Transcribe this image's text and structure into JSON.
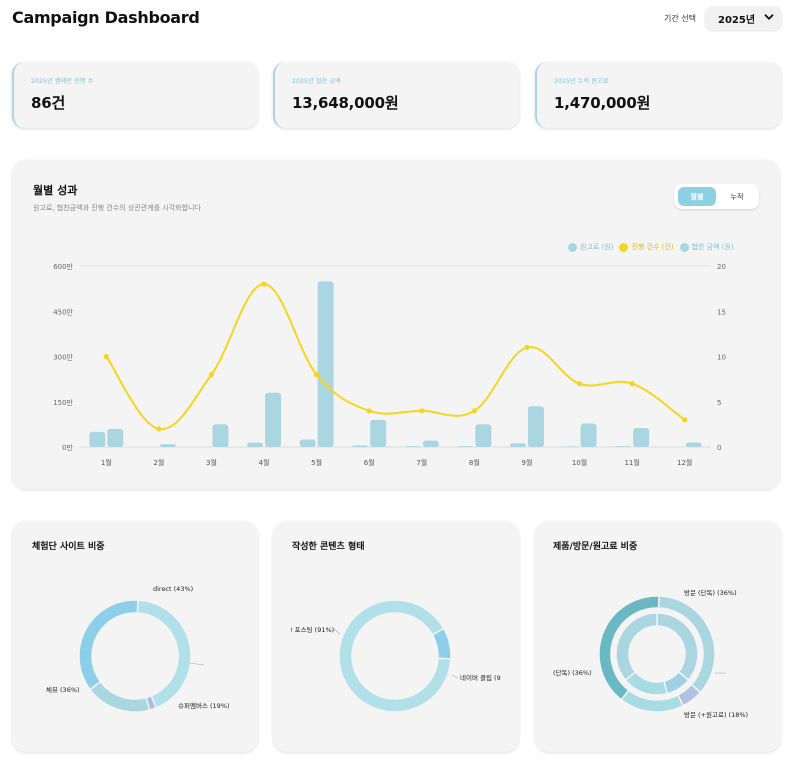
{
  "header": {
    "title": "Campaign Dashboard",
    "period_label": "기간 선택",
    "period_value": "2025년"
  },
  "stats": [
    {
      "label": "2025년 캠페인 진행 수",
      "value": "86건"
    },
    {
      "label": "2025년 협찬 금액",
      "value": "13,648,000원"
    },
    {
      "label": "2025년 누적 원고료",
      "value": "1,470,000원"
    }
  ],
  "monthly": {
    "title": "월별 성과",
    "subtitle": "원고료, 협찬금액과 진행 건수의 상관관계를 시각화합니다",
    "toggle": [
      "월별",
      "누적"
    ],
    "legend": [
      {
        "label": "원고료 (원)",
        "color": "#a9d6e1"
      },
      {
        "label": "진행 건수 (건)",
        "color": "#f7d51c"
      },
      {
        "label": "협찬 금액 (원)",
        "color": "#a9d6e1"
      }
    ]
  },
  "chart_data": [
    {
      "type": "bar",
      "categories": [
        "1월",
        "2월",
        "3월",
        "4월",
        "5월",
        "6월",
        "7월",
        "8월",
        "9월",
        "10월",
        "11월",
        "12월"
      ],
      "series": [
        {
          "name": "원고료 (원)",
          "type": "bar",
          "axis": "left",
          "values": [
            500000,
            0,
            0,
            150000,
            250000,
            50000,
            30000,
            30000,
            120000,
            20000,
            30000,
            0
          ],
          "color": "#a9d6e1"
        },
        {
          "name": "진행 건수 (건)",
          "type": "line",
          "axis": "right",
          "values": [
            10,
            2,
            8,
            18,
            8,
            4,
            4,
            4,
            11,
            7,
            7,
            3
          ],
          "color": "#f7d51c"
        },
        {
          "name": "협찬 금액 (원)",
          "type": "bar",
          "axis": "right",
          "values": [
            2,
            0.3,
            2.5,
            6,
            18.3,
            3,
            0.7,
            2.5,
            4.5,
            2.6,
            2.1,
            0.5
          ],
          "color": "#a9d6e1"
        }
      ],
      "y_left": {
        "ticks": [
          "0만",
          "150만",
          "300만",
          "450만",
          "600만"
        ],
        "range": [
          0,
          6000000
        ]
      },
      "y_right": {
        "ticks": [
          "0",
          "5",
          "10",
          "15",
          "20"
        ],
        "range": [
          0,
          20
        ]
      },
      "grid": false,
      "legend": "top-right"
    },
    {
      "type": "pie",
      "title": "체험단 사이트 비중",
      "labels": [
        "direct (43%)",
        "",
        "슈퍼멤버스 (19%)",
        "체뷰 (36%)"
      ],
      "values": [
        43,
        2,
        19,
        36
      ],
      "colors": [
        "#b2e0e8",
        "#a9bde6",
        "#a9d6e1",
        "#8dcfe8"
      ]
    },
    {
      "type": "pie",
      "title": "작성한 콘텐츠 형태",
      "labels": [
        "! 포스팅 (91%)",
        "네이버 클립 (9"
      ],
      "values": [
        91,
        9
      ],
      "colors": [
        "#b2e0e8",
        "#8dcfe8"
      ]
    },
    {
      "type": "pie",
      "title": "제품/방문/원고료 비중",
      "outer": {
        "labels": [
          "방문 (단독) (36%)",
          "",
          "방문 (+원고료) (18%)",
          "(단독) (36%)"
        ],
        "values": [
          36,
          6,
          18,
          40
        ],
        "colors": [
          "#a9d6e1",
          "#afc3e0",
          "#a8dce3",
          "#69b8c4"
        ]
      },
      "inner": {
        "values": [
          36,
          10,
          18,
          36
        ],
        "colors": [
          "#a9d6e1",
          "#9fd0e6",
          "#a8dce3",
          "#a9d6e1"
        ]
      }
    }
  ]
}
